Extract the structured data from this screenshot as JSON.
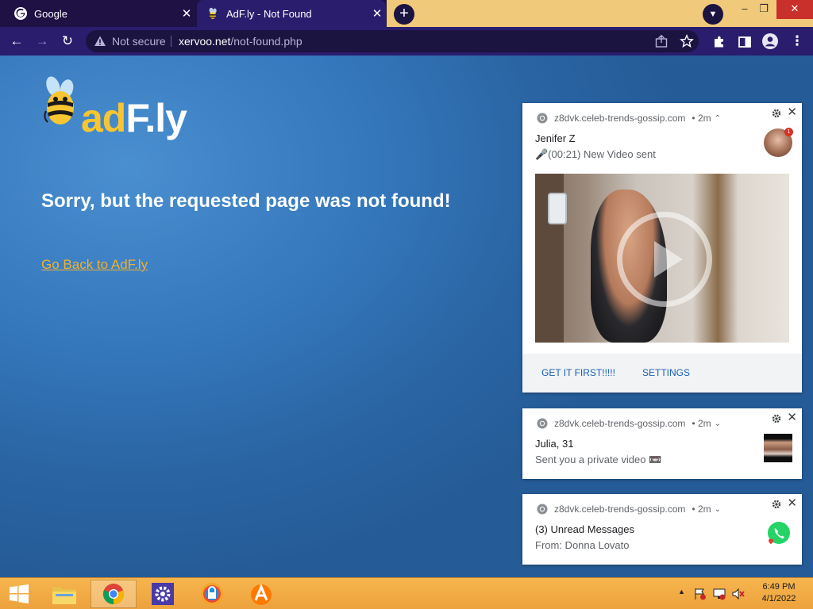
{
  "browser": {
    "tabs": [
      {
        "title": "Google",
        "active": false
      },
      {
        "title": "AdF.ly - Not Found",
        "active": true
      }
    ],
    "address": {
      "security_label": "Not secure",
      "host": "xervoo.net",
      "path": "/not-found.php"
    },
    "window_controls": {
      "minimize": "–",
      "maximize": "❐",
      "close": "✕"
    }
  },
  "page": {
    "logo": {
      "part1": "ad",
      "part2": "F.ly"
    },
    "heading": "Sorry, but the requested page was not found!",
    "back_link": "Go Back to AdF.ly"
  },
  "notifications": [
    {
      "source": "z8dvk.celeb-trends-gossip.com",
      "time": "• 2m",
      "expanded": true,
      "title": "Jenifer Z",
      "body": "🎤(00:21) New Video sent",
      "badge": "1",
      "actions": [
        "GET IT FIRST!!!!!",
        "SETTINGS"
      ]
    },
    {
      "source": "z8dvk.celeb-trends-gossip.com",
      "time": "• 2m",
      "expanded": false,
      "title": "Julia, 31",
      "body": "Sent you a private video 📼"
    },
    {
      "source": "z8dvk.celeb-trends-gossip.com",
      "time": "• 2m",
      "expanded": false,
      "title": "(3) Unread Messages",
      "body": "From: Donna Lovato"
    }
  ],
  "taskbar": {
    "pinned": [
      "start-button",
      "file-explorer",
      "chrome",
      "settings-app",
      "browser-app",
      "avast-app"
    ],
    "clock": {
      "time": "6:49 PM",
      "date": "4/1/2022"
    }
  },
  "colors": {
    "tab_strip": "#1f1144",
    "active_tab": "#2a1d6e",
    "page_background": "#2a64a3",
    "link_color": "#f0b030",
    "logo_yellow": "#f7c531",
    "taskbar": "#f0a843"
  }
}
